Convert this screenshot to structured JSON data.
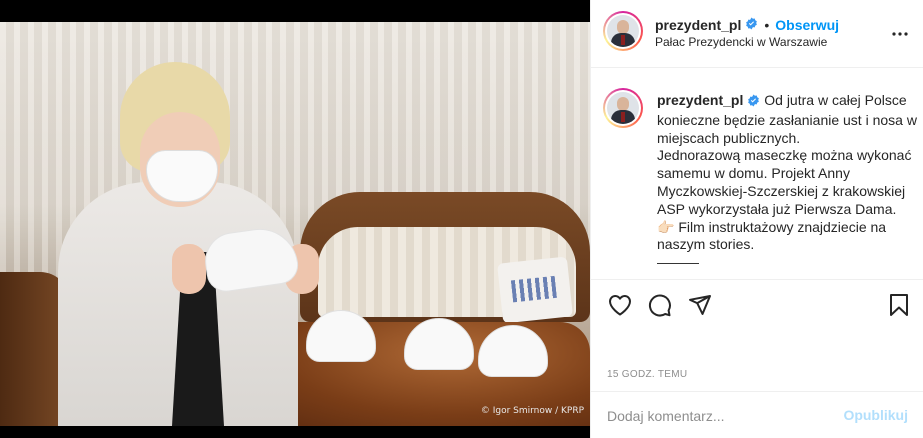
{
  "photo": {
    "credit": "© Igor Smirnow / KPRP"
  },
  "header": {
    "username": "prezydent_pl",
    "verified_icon": "verified-badge-icon",
    "separator": "•",
    "follow_label": "Obserwuj",
    "location": "Pałac Prezydencki w Warszawie",
    "more_icon": "more-options-icon"
  },
  "caption": {
    "username": "prezydent_pl",
    "text": " Od jutra w całej Polsce konieczne będzie zasłanianie ust i nosa w miejscach publicznych.\nJednorazową maseczkę można wykonać samemu w domu. Projekt Anny Myczkowskiej-Szczerskiej z krakowskiej ASP wykorzystała już Pierwsza Dama.\n👉🏻 Film instruktażowy znajdziecie na naszym stories.\n———"
  },
  "actions": {
    "like_icon": "heart-icon",
    "comment_icon": "comment-icon",
    "share_icon": "paper-plane-icon",
    "save_icon": "bookmark-icon",
    "timestamp": "15 godz. temu"
  },
  "add_comment": {
    "placeholder": "Dodaj komentarz...",
    "publish_label": "Opublikuj"
  },
  "colors": {
    "accent": "#0095f6",
    "publish_disabled": "#b2dffc",
    "muted": "#8e8e8e"
  }
}
